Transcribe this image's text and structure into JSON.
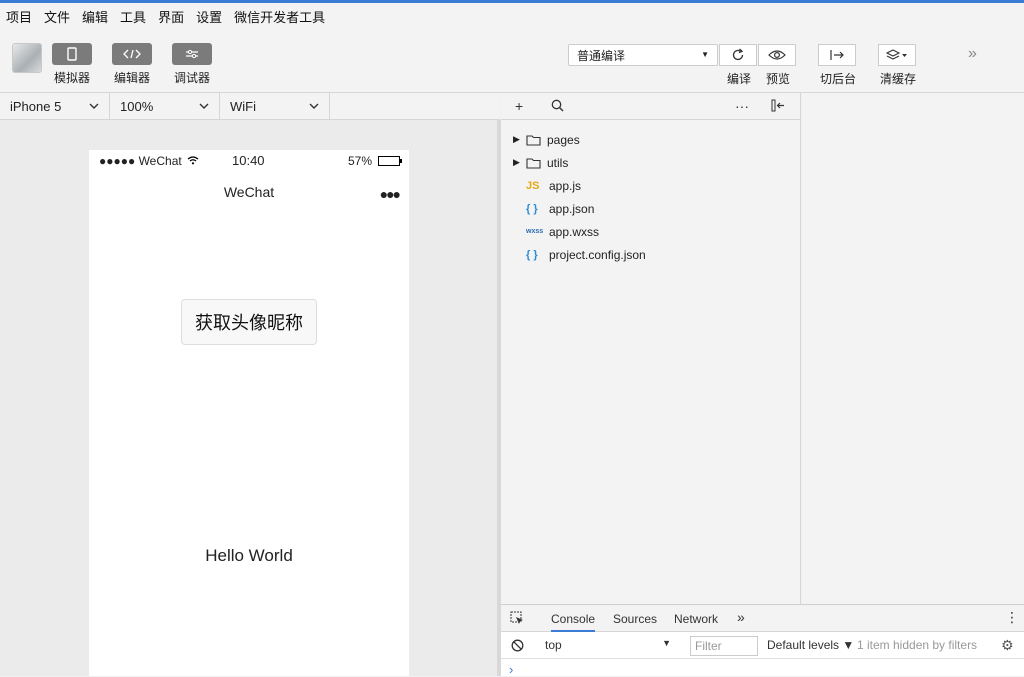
{
  "menu": [
    "项目",
    "文件",
    "编辑",
    "工具",
    "界面",
    "设置",
    "微信开发者工具"
  ],
  "toolbar": {
    "simulator": "模拟器",
    "editor": "编辑器",
    "debugger": "调试器",
    "compile_mode": "普通编译",
    "compile": "编译",
    "preview": "预览",
    "background": "切后台",
    "clear_cache": "清缓存"
  },
  "device_bar": {
    "device": "iPhone 5",
    "zoom": "100%",
    "network": "WiFi"
  },
  "phone": {
    "carrier": "●●●●● WeChat",
    "time": "10:40",
    "battery": "57%",
    "battery_level": 0.57,
    "nav_title": "WeChat",
    "avatar_button": "获取头像昵称",
    "hello": "Hello World"
  },
  "files": [
    {
      "name": "pages",
      "type": "folder"
    },
    {
      "name": "utils",
      "type": "folder"
    },
    {
      "name": "app.js",
      "type": "js",
      "icon_label": "JS"
    },
    {
      "name": "app.json",
      "type": "json",
      "icon_label": "{ }"
    },
    {
      "name": "app.wxss",
      "type": "wxss",
      "icon_label": "wxss"
    },
    {
      "name": "project.config.json",
      "type": "json",
      "icon_label": "{ }"
    }
  ],
  "console": {
    "tabs": [
      "Console",
      "Sources",
      "Network"
    ],
    "context": "top",
    "filter_placeholder": "Filter",
    "levels": "Default levels ▼",
    "hidden": "1 item hidden by filters"
  },
  "colors": {
    "accent": "#3a7bd5",
    "button_gray": "#7b7b7b",
    "js": "#e6a817",
    "json": "#2a8bd6"
  }
}
